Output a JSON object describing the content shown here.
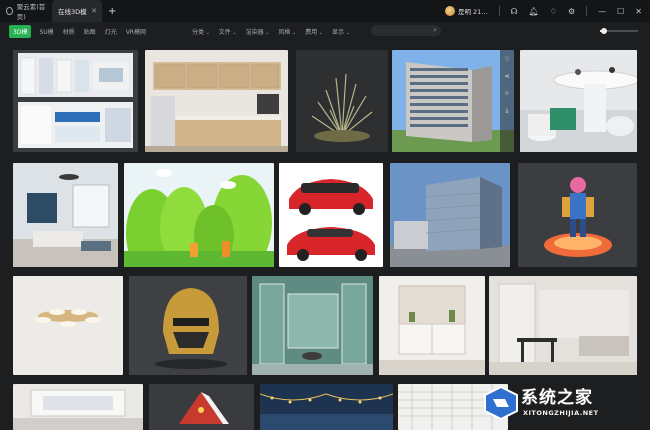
{
  "titlebar": {
    "tabs": [
      {
        "label": "聚云素(首页)",
        "closable": false
      },
      {
        "label": "在线3D模",
        "closable": true
      }
    ],
    "new_tab": "+",
    "user": {
      "name": "是明 21..."
    },
    "icons": [
      "headset-icon",
      "bell-icon",
      "skin-icon",
      "settings-icon",
      "minimize-icon",
      "maximize-icon",
      "close-icon"
    ]
  },
  "toolbar": {
    "categories": [
      "3D模",
      "SU模",
      "材质",
      "贴图",
      "灯光",
      "VR模网"
    ],
    "active_category_index": 0,
    "filters": [
      "分类",
      "文件",
      "渲染器",
      "风格",
      "费用",
      "显示"
    ],
    "search": {
      "placeholder": "",
      "value": ""
    },
    "zoom_level": 0.1
  },
  "watermark": {
    "title": "系统之家",
    "url": "XITONGZHIJIA.NET"
  },
  "colors": {
    "accent": "#27b153",
    "bg": "#1d1e20",
    "titlebar": "#141517"
  }
}
